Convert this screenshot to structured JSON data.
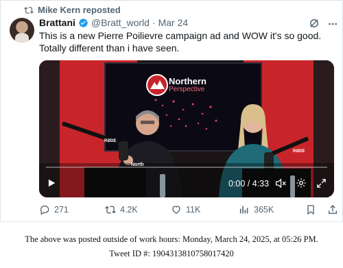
{
  "repost": {
    "text": "Mike Kern reposted"
  },
  "tweet": {
    "display_name": "Brattani",
    "handle": "@Bratt_world",
    "separator": "·",
    "date": "Mar 24",
    "text": "This is a new Pierre Poilievre campaign ad and WOW it's so good. Totally different than i have seen."
  },
  "video": {
    "logo_line1": "Northern",
    "logo_line2": "Perspective",
    "mic_label_left": "RØDE",
    "mic_label_right": "RØDE",
    "shirt_text": "North",
    "time": "0:00 / 4:33",
    "progress": 0
  },
  "actions": {
    "replies": "271",
    "reposts": "4.2K",
    "likes": "11K",
    "views": "365K"
  },
  "caption": {
    "line1": "The above was posted outside of work hours: Monday, March 24, 2025, at 05:26 PM.",
    "line2": "Tweet ID #: 1904313810758017420"
  },
  "colors": {
    "verified": "#1d9bf0",
    "muted_text": "#536471",
    "studio_red": "#c8252b"
  }
}
